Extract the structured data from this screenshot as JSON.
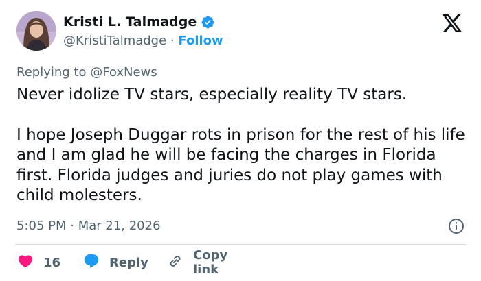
{
  "author": {
    "name": "Kristi L. Talmadge",
    "handle": "@KristiTalmadge",
    "separator": "·",
    "follow_label": "Follow",
    "verified": true
  },
  "reply_context": {
    "prefix": "Replying to",
    "mention": "@FoxNews"
  },
  "tweet": {
    "paragraphs": [
      "Never idolize TV stars, especially reality TV stars.",
      "I hope Joseph Duggar rots in prison for the rest of his life and I am glad he will be facing the charges in Florida first. Florida judges and juries do not play games with child molesters."
    ],
    "timestamp": "5:05 PM · Mar 21, 2026"
  },
  "actions": {
    "like_count": "16",
    "reply_label": "Reply",
    "copy_label": "Copy link"
  },
  "icons": {
    "verified": "verified-badge-icon",
    "platform": "x-logo-icon",
    "info": "info-icon",
    "like": "heart-icon",
    "reply": "reply-bubble-icon",
    "copy": "link-icon"
  },
  "colors": {
    "accent": "#1d9bf0",
    "like": "#f91880",
    "muted": "#536471",
    "text": "#0f1419",
    "divider": "#cfd9de"
  }
}
